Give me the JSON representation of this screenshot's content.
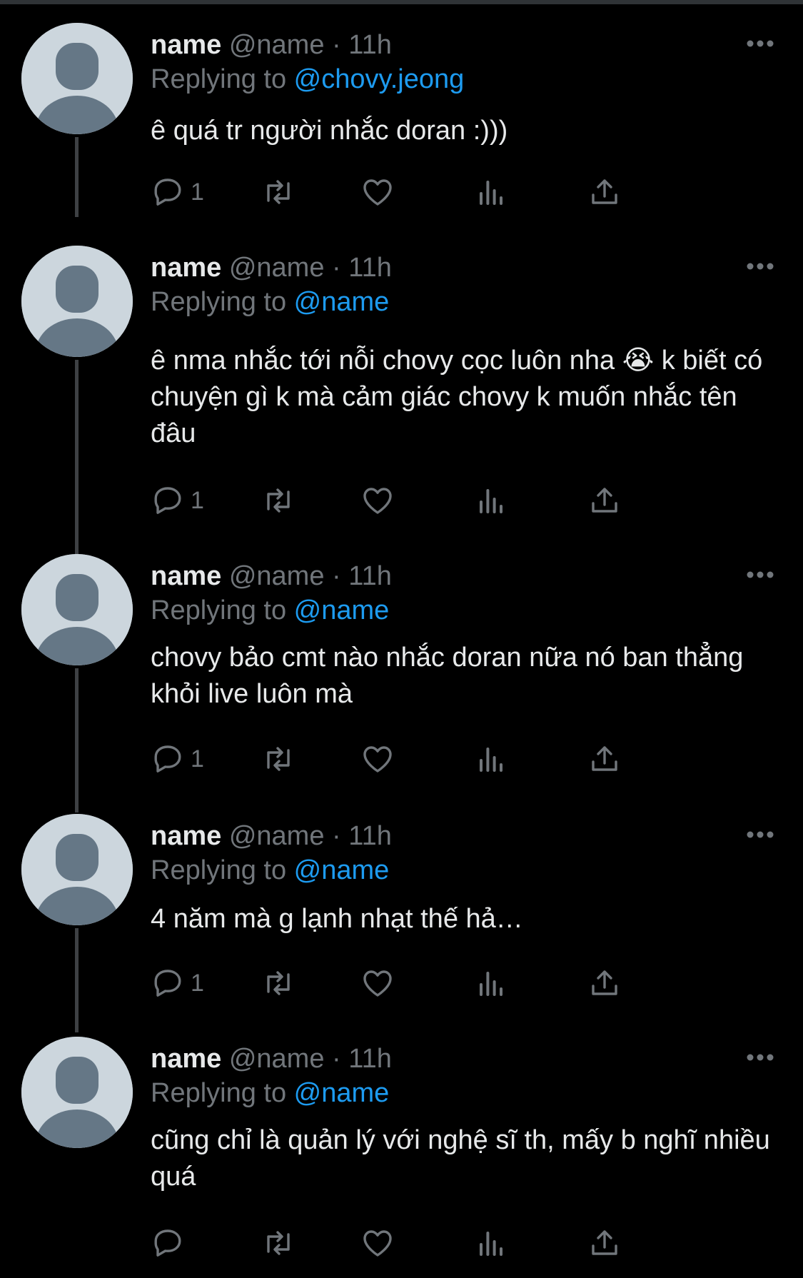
{
  "thread": {
    "tweets": [
      {
        "name": "name",
        "handle": "@name",
        "dot": " · ",
        "time": "11h",
        "replying_prefix": "Replying to ",
        "replying_to": "@chovy.jeong",
        "text": "ê quá tr người nhắc doran :)))",
        "reply_count": "1"
      },
      {
        "name": "name",
        "handle": "@name",
        "dot": " · ",
        "time": "11h",
        "replying_prefix": "Replying to ",
        "replying_to": "@name",
        "text": "ê nma nhắc tới nỗi chovy cọc luôn nha 😭  k biết có chuyện gì k mà cảm giác chovy k muốn nhắc tên đâu",
        "reply_count": "1"
      },
      {
        "name": "name",
        "handle": "@name",
        "dot": " · ",
        "time": "11h",
        "replying_prefix": "Replying to ",
        "replying_to": "@name",
        "text": "chovy bảo cmt nào nhắc doran nữa nó ban thẳng khỏi live luôn mà",
        "reply_count": "1"
      },
      {
        "name": "name",
        "handle": "@name",
        "dot": " · ",
        "time": "11h",
        "replying_prefix": "Replying to ",
        "replying_to": "@name",
        "text": "4 năm mà g lạnh nhạt thế hả…",
        "reply_count": "1"
      },
      {
        "name": "name",
        "handle": "@name",
        "dot": " · ",
        "time": "11h",
        "replying_prefix": "Replying to ",
        "replying_to": "@name",
        "text": "cũng chỉ là quản lý với nghệ sĩ th, mấy b nghĩ nhiều quá",
        "reply_count": ""
      }
    ],
    "icons": {
      "reply": "reply-icon",
      "retweet": "retweet-icon",
      "like": "heart-icon",
      "views": "views-icon",
      "share": "share-icon",
      "more": "more-icon"
    },
    "colors": {
      "background": "#000000",
      "text": "#e7e9ea",
      "muted": "#71767b",
      "mention": "#1d9bf0",
      "avatar": "#ccd6dd",
      "avatar_figure": "#657786"
    }
  }
}
